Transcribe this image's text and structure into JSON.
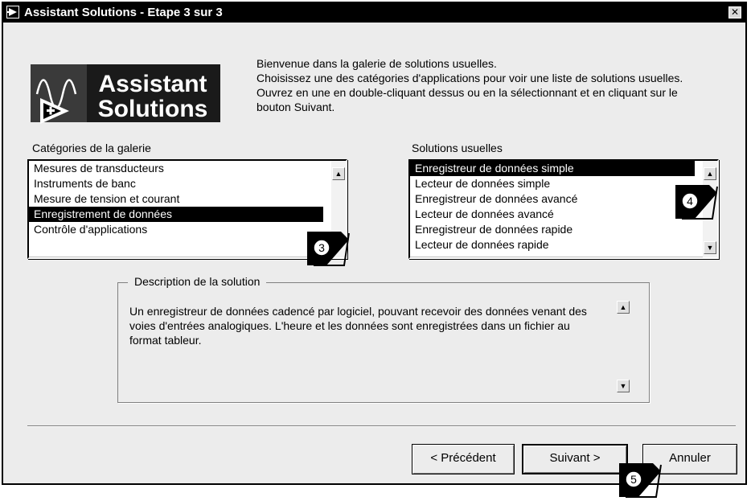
{
  "window": {
    "title": "Assistant Solutions - Etape 3 sur 3"
  },
  "logo": {
    "line1": "Assistant",
    "line2": "Solutions"
  },
  "welcome": {
    "line1": "Bienvenue dans la galerie de solutions usuelles.",
    "line2": "Choisissez une des catégories d'applications pour voir une liste de solutions usuelles. Ouvrez en une en double-cliquant dessus ou en la sélectionnant et en cliquant sur le bouton Suivant."
  },
  "categories": {
    "label": "Catégories de la galerie",
    "items": [
      "Mesures de transducteurs",
      "Instruments de banc",
      "Mesure de tension et courant",
      "Enregistrement de données",
      "Contrôle d'applications"
    ],
    "selected_index": 3
  },
  "solutions": {
    "label": "Solutions usuelles",
    "items": [
      "Enregistreur de données simple",
      "Lecteur de données simple",
      "Enregistreur de données avancé",
      "Lecteur de données avancé",
      "Enregistreur de données rapide",
      "Lecteur de données rapide"
    ],
    "selected_index": 0
  },
  "description": {
    "legend": "Description de la solution",
    "text": "Un enregistreur de données cadencé par logiciel, pouvant recevoir des données venant des voies d'entrées analogiques. L'heure et les données sont enregistrées dans un fichier au format tableur."
  },
  "buttons": {
    "previous": "< Précédent",
    "next": "Suivant >",
    "cancel": "Annuler"
  },
  "callouts": {
    "c3": "3",
    "c4": "4",
    "c5": "5"
  }
}
